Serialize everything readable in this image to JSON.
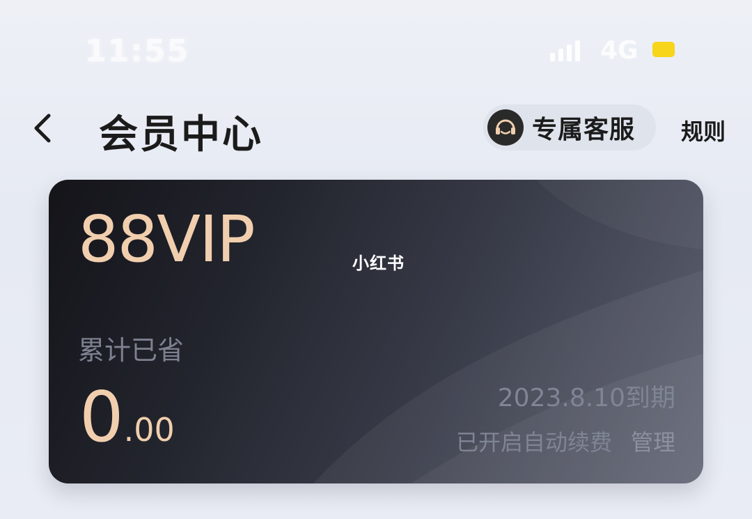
{
  "status_bar": {
    "time": "11:55",
    "network": "4G",
    "signal_icon": "signal-bars-icon",
    "battery_icon": "battery-icon",
    "battery_color": "#f6d51b"
  },
  "header": {
    "back_icon": "chevron-left-icon",
    "title": "会员中心",
    "service_button_label": "专属客服",
    "service_icon": "headset-icon",
    "rules_label": "规则"
  },
  "card": {
    "brand": "88VIP",
    "watermark": "小红书",
    "saved_label": "累计已省",
    "saved_amount_integer": "0",
    "saved_amount_decimal": ".00",
    "expiry": "2023.8.10到期",
    "auto_renew": "已开启自动续费",
    "manage_label": "管理",
    "accent_color": "#f1cfae"
  }
}
